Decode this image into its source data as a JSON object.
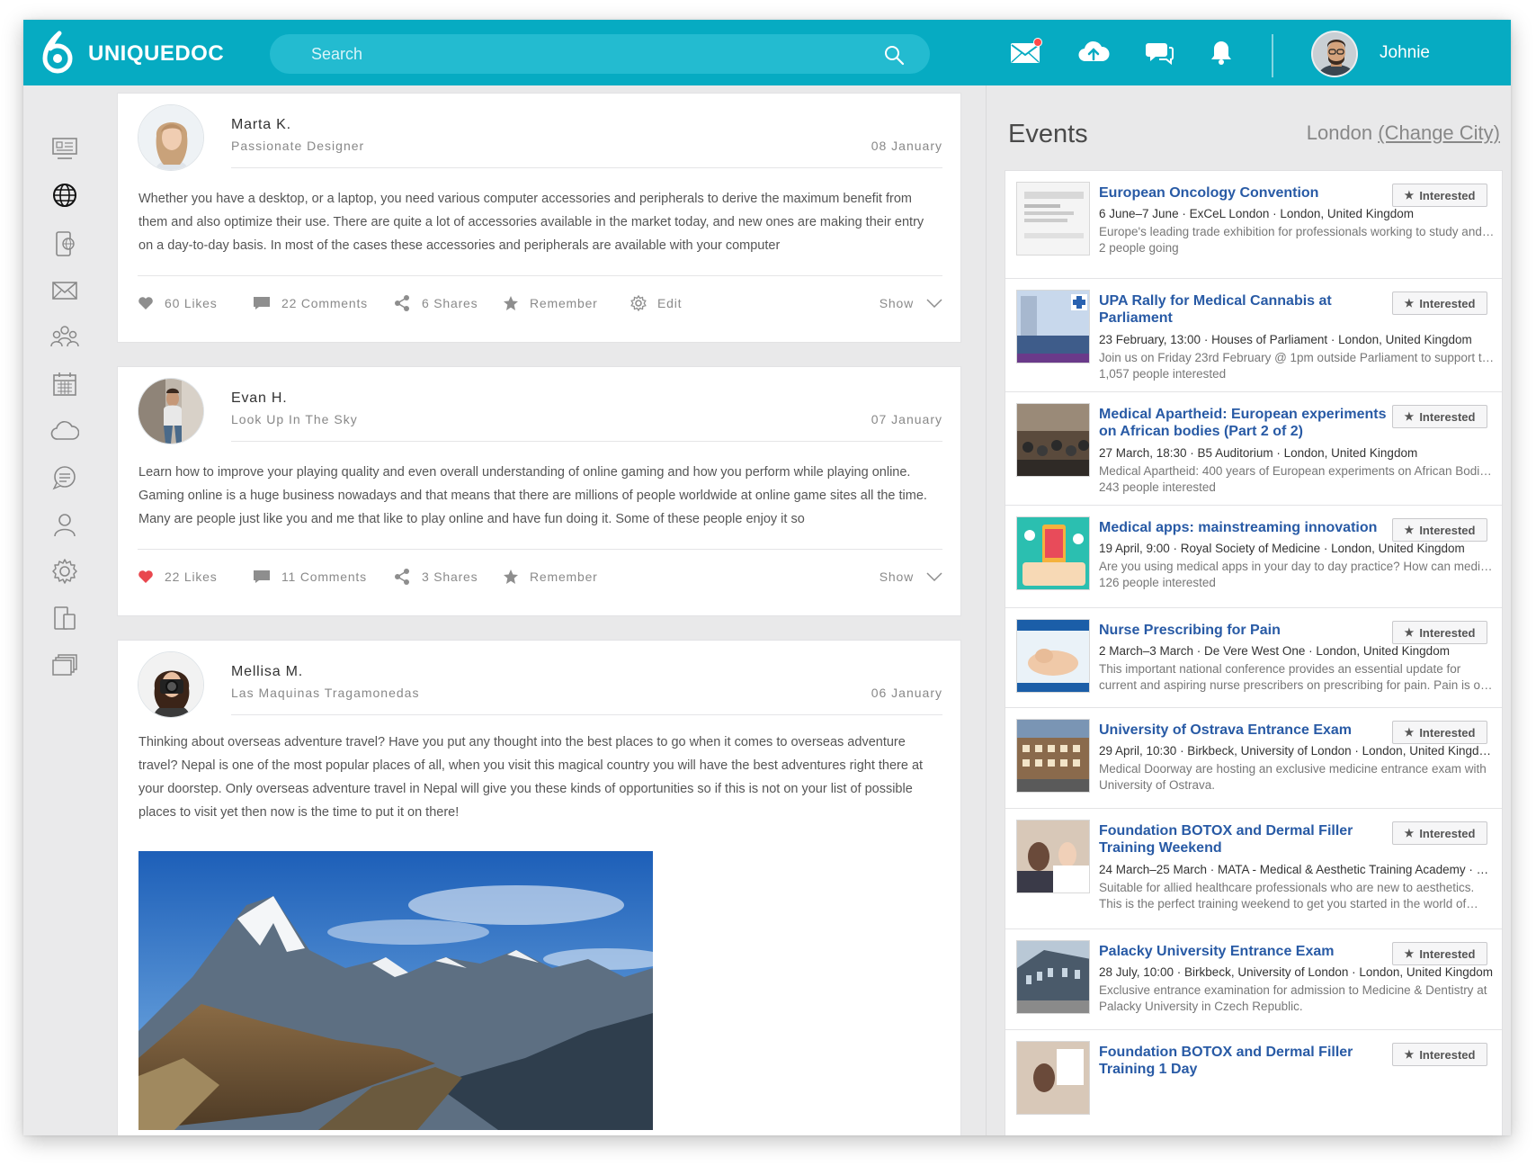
{
  "app": {
    "brand": "UNIQUEDOC",
    "search_placeholder": "Search",
    "user_name": "Johnie"
  },
  "colors": {
    "topbar": "#06abc2",
    "link": "#285aa5",
    "liked_heart": "#e9474e"
  },
  "posts": [
    {
      "author": "Marta K.",
      "subtitle": "Passionate Designer",
      "date": "08 January",
      "text": "Whether you have a desktop, or a laptop, you need various computer accessories and peripherals to derive the maximum benefit from them and also optimize their use. There are quite a lot of accessories available in the market today, and new ones are making their entry on a day-to-day basis. In most of the cases these accessories and peripherals are available with your computer",
      "likes": "60 Likes",
      "comments": "22 Comments",
      "shares": "6 Shares",
      "remember": "Remember",
      "edit": "Edit",
      "show": "Show",
      "liked": false
    },
    {
      "author": "Evan H.",
      "subtitle": "Look Up In The Sky",
      "date": "07 January",
      "text": "Learn how to improve your playing quality and even overall understanding of online gaming and how you perform while playing online. Gaming online is a huge business nowadays and that means that there are millions of people worldwide at online game sites all the time. Many are people just like you and me that like to play online and have fun doing it. Some of these people enjoy it so",
      "likes": "22 Likes",
      "comments": "11 Comments",
      "shares": "3 Shares",
      "remember": "Remember",
      "show": "Show",
      "liked": true
    },
    {
      "author": "Mellisa M.",
      "subtitle": "Las Maquinas Tragamonedas",
      "date": "06 January",
      "text": "Thinking about overseas adventure travel? Have you put any thought into the best places to go when it comes to overseas adventure travel? Nepal is one of the most popular places of all, when you visit this magical country you will have the best adventures right there at your doorstep. Only overseas adventure travel in Nepal will give you these kinds of opportunities so if this is not on your list of possible places to visit yet then now is the time to put it on there!"
    }
  ],
  "events": {
    "title": "Events",
    "city": "London",
    "change_city": "(Change City)",
    "interested_label": "Interested",
    "items": [
      {
        "title": "European Oncology Convention",
        "meta": "6 June–7 June · ExCeL London · London, United Kingdom",
        "desc": "Europe's leading trade exhibition for professionals working to study and treat cancer",
        "count": "2 people going"
      },
      {
        "title": "UPA Rally for Medical Cannabis at Parliament",
        "meta": "23 February, 13:00 · Houses of Parliament · London, United Kingdom",
        "desc": "Join us on Friday 23rd February @ 1pm outside Parliament to support the campaign",
        "count": "1,057 people interested"
      },
      {
        "title": "Medical Apartheid: European experiments on African bodies (Part 2 of 2)",
        "meta": "27 March, 18:30 · B5 Auditorium · London, United Kingdom",
        "desc": "Medical Apartheid: 400 years of European experiments on African Bodies in medicine",
        "count": "243 people interested"
      },
      {
        "title": "Medical apps: mainstreaming innovation",
        "meta": "19 April, 9:00 · Royal Society of Medicine · London, United Kingdom",
        "desc": "Are you using medical apps in your day to day practice? How can medical apps help you",
        "count": "126 people interested"
      },
      {
        "title": "Nurse Prescribing for Pain",
        "meta": "2 March–3 March · De Vere West One · London, United Kingdom",
        "desc": "This important national conference provides an essential update for current and aspiring nurse prescribers on prescribing for pain. Pain is one of the most common symptoms"
      },
      {
        "title": "University of Ostrava Entrance Exam",
        "meta": "29 April, 10:30 · Birkbeck, University of London · London, United Kingdom",
        "desc": "Medical Doorway are hosting an exclusive medicine entrance exam with University of Ostrava."
      },
      {
        "title": "Foundation BOTOX and Dermal Filler Training Weekend",
        "meta": "24 March–25 March · MATA - Medical & Aesthetic Training Academy · London",
        "desc": "Suitable for allied healthcare professionals who are new to aesthetics. This is the perfect training weekend to get you started in the world of aesthetics"
      },
      {
        "title": "Palacky University Entrance Exam",
        "meta": "28 July, 10:00 · Birkbeck, University of London · London, United Kingdom",
        "desc": "Exclusive entrance examination for admission to Medicine & Dentistry at Palacky University in Czech Republic."
      },
      {
        "title": "Foundation BOTOX and Dermal Filler Training 1 Day"
      }
    ]
  }
}
